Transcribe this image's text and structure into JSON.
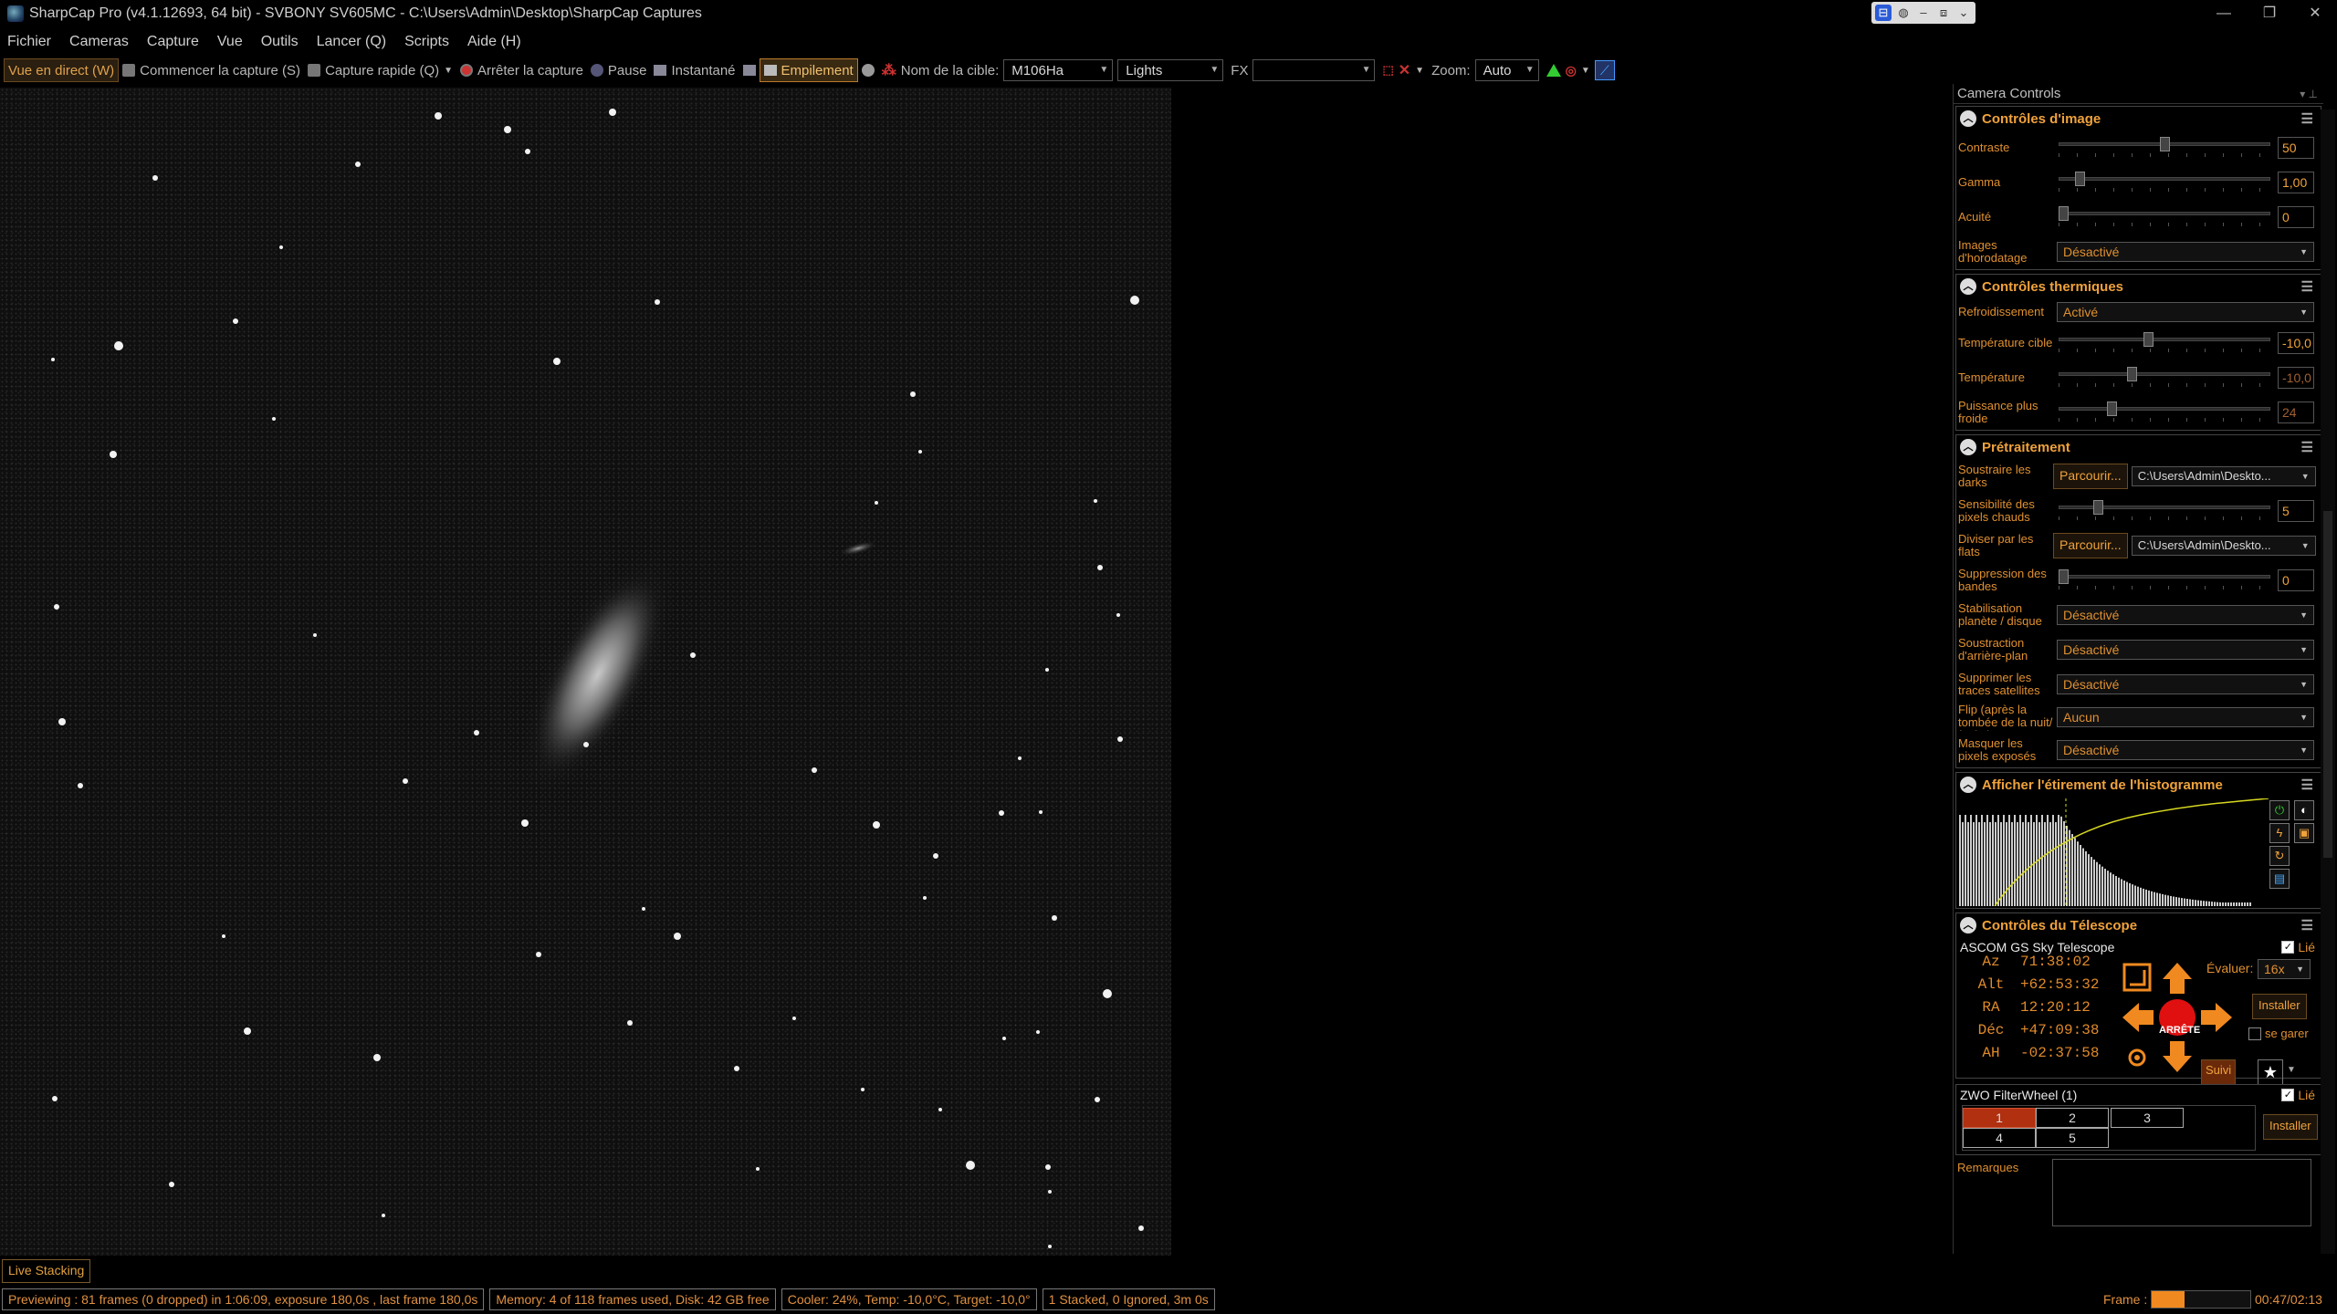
{
  "window": {
    "title": "SharpCap Pro (v4.1.12693, 64 bit) - SVBONY SV605MC - C:\\Users\\Admin\\Desktop\\SharpCap Captures"
  },
  "menu": [
    "Fichier",
    "Cameras",
    "Capture",
    "Vue",
    "Outils",
    "Lancer (Q)",
    "Scripts",
    "Aide (H)"
  ],
  "toolbar": {
    "live_view": "Vue en direct (W)",
    "start_capture": "Commencer la capture (S)",
    "quick_capture": "Capture rapide (Q)",
    "stop_capture": "Arrêter la capture",
    "pause": "Pause",
    "snapshot": "Instantané",
    "stacking": "Empilement",
    "target_label": "Nom de la cible:",
    "target_value": "M106Ha",
    "frame_type": "Lights",
    "fx_label": "FX",
    "fx_value": "",
    "zoom_label": "Zoom:",
    "zoom_value": "Auto"
  },
  "panel": {
    "title": "Camera Controls",
    "image_controls": {
      "title": "Contrôles d'image",
      "contrast_label": "Contraste",
      "contrast_value": "50",
      "contrast_level": 0.5,
      "gamma_label": "Gamma",
      "gamma_value": "1,00",
      "gamma_level": 0.08,
      "sharpness_label": "Acuité",
      "sharpness_value": "0",
      "sharpness_level": 0.0,
      "timestamp_label": "Images d'horodatage",
      "timestamp_value": "Désactivé"
    },
    "thermal": {
      "title": "Contrôles thermiques",
      "cooling_label": "Refroidissement",
      "cooling_value": "Activé",
      "target_temp_label": "Température cible",
      "target_temp_value": "-10,0",
      "target_temp_level": 0.42,
      "temp_label": "Température",
      "temp_value": "-10,0",
      "temp_level": 0.34,
      "power_label": "Puissance plus froide",
      "power_value": "24",
      "power_level": 0.24
    },
    "preprocessing": {
      "title": "Prétraitement",
      "darks_label": "Soustraire les darks",
      "darks_button": "Parcourir...",
      "darks_path": "C:\\Users\\Admin\\Deskto...",
      "hotpix_label": "Sensibilité des pixels chauds",
      "hotpix_value": "5",
      "hotpix_level": 0.17,
      "flats_label": "Diviser par les flats",
      "flats_button": "Parcourir...",
      "flats_path": "C:\\Users\\Admin\\Deskto...",
      "banding_label": "Suppression des bandes",
      "banding_value": "0",
      "banding_level": 0.0,
      "stab_label": "Stabilisation planète / disque",
      "stab_value": "Désactivé",
      "bgsub_label": "Soustraction d'arrière-plan",
      "bgsub_value": "Désactivé",
      "sat_label": "Supprimer les traces satellites",
      "sat_value": "Désactivé",
      "flip_label": "Flip (après la tombée de la nuit/à plat)",
      "flip_value": "Aucun",
      "mask_label": "Masquer les pixels exposés",
      "mask_value": "Désactivé"
    },
    "histogram": {
      "title": "Afficher l'étirement de l'histogramme"
    },
    "telescope": {
      "title": "Contrôles du Télescope",
      "name": "ASCOM GS Sky Telescope",
      "linked_label": "Lié",
      "coords": [
        {
          "k": "Az",
          "v": "71:38:02"
        },
        {
          "k": "Alt",
          "v": "+62:53:32"
        },
        {
          "k": "RA",
          "v": "12:20:12"
        },
        {
          "k": "Déc",
          "v": "+47:09:38"
        },
        {
          "k": "AH",
          "v": "-02:37:58"
        }
      ],
      "rate_label": "Évaluer:",
      "rate_value": "16x",
      "setup_button": "Installer",
      "park_label": "se garer",
      "stop_label": "ARRÊTE",
      "track_button": "Suivi"
    },
    "filterwheel": {
      "name": "ZWO FilterWheel (1)",
      "linked_label": "Lié",
      "slots": [
        "1",
        "2",
        "3",
        "4",
        "5"
      ],
      "active_slot": "1",
      "setup_button": "Installer"
    },
    "notes": {
      "label": "Remarques"
    }
  },
  "status": {
    "live_stacking": "Live Stacking",
    "preview": "Previewing : 81 frames (0 dropped) in 1:06:09, exposure 180,0s , last frame 180,0s",
    "memory": "Memory: 4 of 118 frames used, Disk: 42 GB free",
    "cooler": "Cooler: 24%, Temp: -10,0°C, Target: -10,0°",
    "stack": "1 Stacked, 0 Ignored, 3m 0s",
    "frame_label": "Frame :",
    "frame_progress": 0.33,
    "frame_time": "00:47/02:13"
  },
  "colors": {
    "accent": "#f0a23c",
    "bg": "#000000",
    "stop_red": "#e01010",
    "arrow_orange": "#f08a20"
  }
}
